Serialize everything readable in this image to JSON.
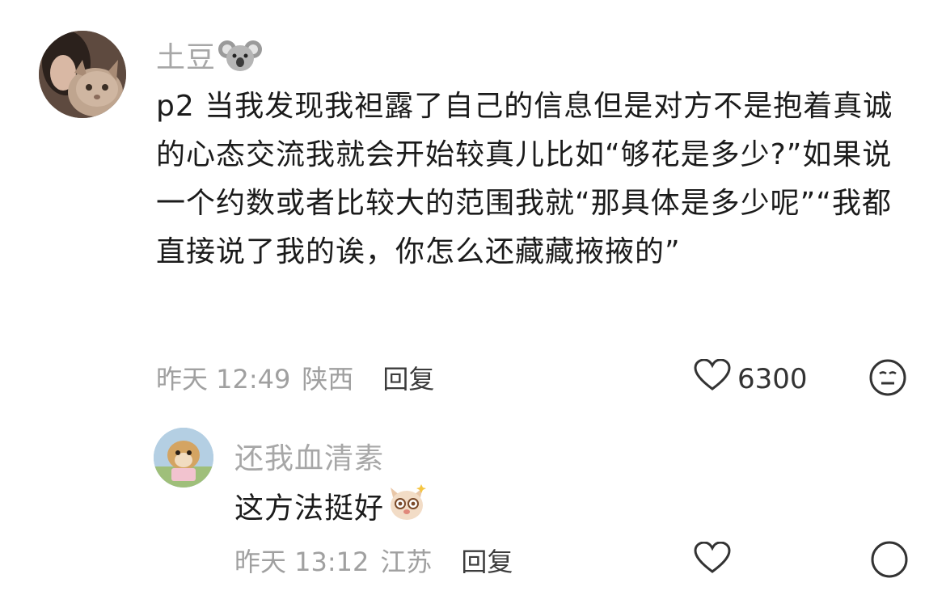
{
  "comments": [
    {
      "username": "土豆",
      "username_sticker": "koala-icon",
      "text": "p2 当我发现我袒露了自己的信息但是对方不是抱着真诚的心态交流我就会开始较真儿比如“够花是多少?”如果说一个约数或者比较大的范围我就“那具体是多少呢”“我都直接说了我的诶，你怎么还藏藏掖掖的”",
      "time": "昨天 12:49",
      "location": "陕西",
      "reply_label": "回复",
      "likes": "6300"
    },
    {
      "username": "还我血清素",
      "text": "这方法挺好",
      "text_sticker": "cat-sticker-icon",
      "time": "昨天 13:12",
      "location": "江苏",
      "reply_label": "回复",
      "likes": ""
    }
  ],
  "colors": {
    "username": "#a7a7a7",
    "body": "#1b1b1b",
    "meta": "#a0a0a0",
    "reply": "#3c3c3c"
  }
}
